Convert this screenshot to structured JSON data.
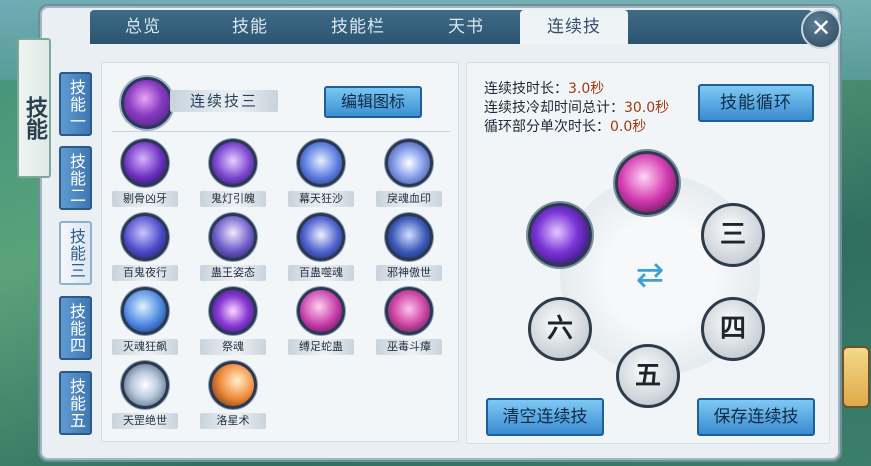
{
  "tabs": [
    "总览",
    "技能",
    "技能栏",
    "天书",
    "连续技"
  ],
  "active_tab": "连续技",
  "side_title": "技能",
  "side_tabs": [
    "技能一",
    "技能二",
    "技能三",
    "技能四",
    "技能五"
  ],
  "active_side_tab": "技能三",
  "combo": {
    "name": "连续技三",
    "edit_label": "编辑图标"
  },
  "skills": [
    "剔骨凶牙",
    "鬼灯引魄",
    "幕天狂沙",
    "戾魂血印",
    "百鬼夜行",
    "蛊王姿态",
    "百蛊噬魂",
    "邪神傲世",
    "灭魂狂飙",
    "祭魂",
    "缚足蛇蛊",
    "巫毒斗瘴",
    "天罡绝世",
    "洛星术"
  ],
  "info": {
    "duration_label": "连续技时长：",
    "duration_value": "3.0秒",
    "cooldown_label": "连续技冷却时间总计：",
    "cooldown_value": "30.0秒",
    "loop_label": "循环部分单次时长：",
    "loop_value": "0.0秒"
  },
  "buttons": {
    "cycle": "技能循环",
    "clear": "清空连续技",
    "save": "保存连续技",
    "close": "✕"
  },
  "slots": [
    "三",
    "四",
    "五",
    "六"
  ],
  "colors": {
    "tab_bar": "#2c5470",
    "button": "#3a8bd0",
    "value_text": "#9c3b12"
  }
}
